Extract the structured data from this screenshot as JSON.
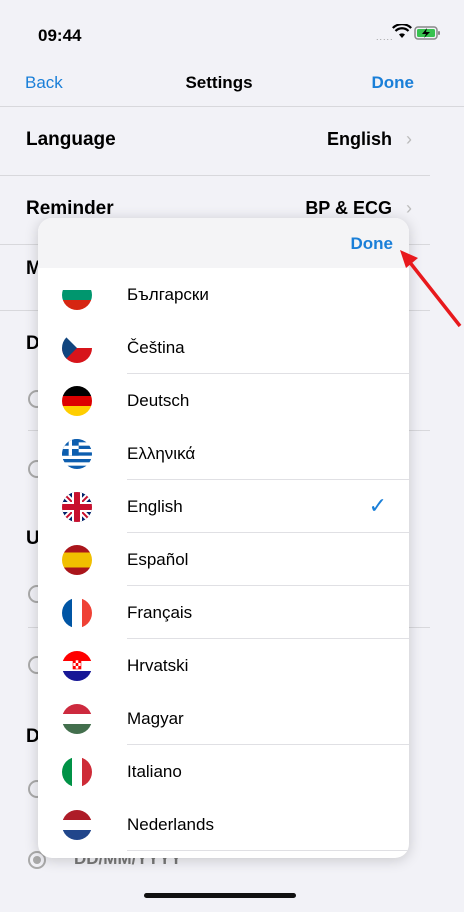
{
  "status_bar": {
    "time": "09:44",
    "signal": "....."
  },
  "nav": {
    "back": "Back",
    "title": "Settings",
    "done": "Done"
  },
  "settings": {
    "language": {
      "label": "Language",
      "value": "English"
    },
    "reminder": {
      "label": "Reminder",
      "value": "BP & ECG"
    },
    "peek_letters": [
      "M",
      "D",
      "U",
      "D"
    ],
    "date_format": "DD/MM/YYYY"
  },
  "language_sheet": {
    "done": "Done",
    "items": [
      {
        "name": "Български",
        "flag": "bulgaria-flag-icon",
        "selected": false
      },
      {
        "name": "Čeština",
        "flag": "czech-flag-icon",
        "selected": false
      },
      {
        "name": "Deutsch",
        "flag": "germany-flag-icon",
        "selected": false
      },
      {
        "name": "Ελληνικά",
        "flag": "greece-flag-icon",
        "selected": false
      },
      {
        "name": "English",
        "flag": "uk-flag-icon",
        "selected": true
      },
      {
        "name": "Español",
        "flag": "spain-flag-icon",
        "selected": false
      },
      {
        "name": "Français",
        "flag": "france-flag-icon",
        "selected": false
      },
      {
        "name": "Hrvatski",
        "flag": "croatia-flag-icon",
        "selected": false
      },
      {
        "name": "Magyar",
        "flag": "hungary-flag-icon",
        "selected": false
      },
      {
        "name": "Italiano",
        "flag": "italy-flag-icon",
        "selected": false
      },
      {
        "name": "Nederlands",
        "flag": "netherlands-flag-icon",
        "selected": false
      }
    ]
  },
  "colors": {
    "accent": "#1a7fd8",
    "annotation_arrow": "#e8191d"
  }
}
